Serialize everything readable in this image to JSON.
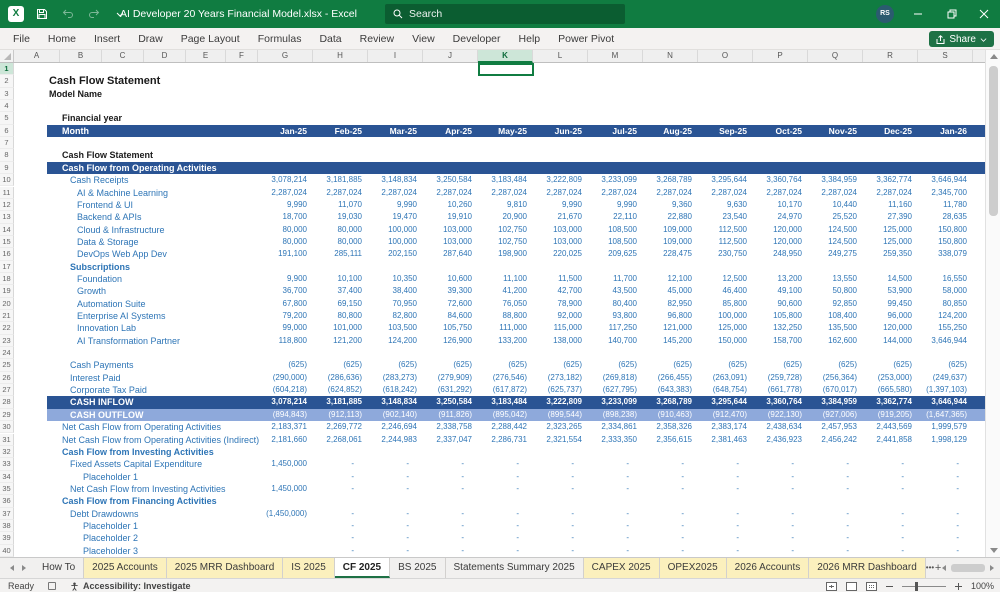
{
  "titlebar": {
    "title": "AI Developer 20 Years Financial Model.xlsx  -  Excel",
    "search_placeholder": "Search",
    "avatar_initials": "RS"
  },
  "menu": {
    "tabs": [
      "File",
      "Home",
      "Insert",
      "Draw",
      "Page Layout",
      "Formulas",
      "Data",
      "Review",
      "View",
      "Developer",
      "Help",
      "Power Pivot"
    ],
    "share_label": "Share"
  },
  "colors": {
    "titlebar_green": "#107C41",
    "banner_blue": "#2A5494",
    "outflow_blue": "#8EA9DB",
    "text_blue": "#2E75B6",
    "tab_yellow": "#FBF0BD",
    "accent_green": "#1E7145"
  },
  "sheet": {
    "columns": [
      "A",
      "B",
      "C",
      "D",
      "E",
      "F",
      "G",
      "H",
      "I",
      "J",
      "K",
      "L",
      "M",
      "N",
      "O",
      "P",
      "Q",
      "R",
      "S"
    ],
    "selected_column": "K",
    "selected_cell": "K1",
    "num_rows": 40,
    "rows": [
      {
        "n": 2,
        "label": "Cash Flow Statement",
        "style": "title",
        "indent": 1
      },
      {
        "n": 3,
        "label": "Model Name",
        "style": "bold",
        "indent": 1
      },
      {
        "n": 5,
        "label": "Financial year",
        "style": "bold",
        "indent": 2
      },
      {
        "n": 6,
        "label": "Month",
        "style": "month",
        "indent": 2,
        "values": [
          "Jan-25",
          "Feb-25",
          "Mar-25",
          "Apr-25",
          "May-25",
          "Jun-25",
          "Jul-25",
          "Aug-25",
          "Sep-25",
          "Oct-25",
          "Nov-25",
          "Dec-25",
          "Jan-26"
        ]
      },
      {
        "n": 8,
        "label": "Cash Flow Statement",
        "style": "bold",
        "indent": 2
      },
      {
        "n": 9,
        "label": "Cash Flow from Operating Activities",
        "style": "banner",
        "indent": 2
      },
      {
        "n": 10,
        "label": "Cash Receipts",
        "style": "blue",
        "indent": 3,
        "values": [
          "3,078,214",
          "3,181,885",
          "3,148,834",
          "3,250,584",
          "3,183,484",
          "3,222,809",
          "3,233,099",
          "3,268,789",
          "3,295,644",
          "3,360,764",
          "3,384,959",
          "3,362,774",
          "3,646,944"
        ]
      },
      {
        "n": 11,
        "label": "AI & Machine Learning",
        "style": "blue",
        "indent": 4,
        "values": [
          "2,287,024",
          "2,287,024",
          "2,287,024",
          "2,287,024",
          "2,287,024",
          "2,287,024",
          "2,287,024",
          "2,287,024",
          "2,287,024",
          "2,287,024",
          "2,287,024",
          "2,287,024",
          "2,345,700"
        ]
      },
      {
        "n": 12,
        "label": "Frontend & UI",
        "style": "blue",
        "indent": 4,
        "values": [
          "9,990",
          "11,070",
          "9,990",
          "10,260",
          "9,810",
          "9,990",
          "9,990",
          "9,360",
          "9,630",
          "10,170",
          "10,440",
          "11,160",
          "11,780"
        ]
      },
      {
        "n": 13,
        "label": "Backend & APIs",
        "style": "blue",
        "indent": 4,
        "values": [
          "18,700",
          "19,030",
          "19,470",
          "19,910",
          "20,900",
          "21,670",
          "22,110",
          "22,880",
          "23,540",
          "24,970",
          "25,520",
          "27,390",
          "28,635"
        ]
      },
      {
        "n": 14,
        "label": "Cloud & Infrastructure",
        "style": "blue",
        "indent": 4,
        "values": [
          "80,000",
          "80,000",
          "100,000",
          "103,000",
          "102,750",
          "103,000",
          "108,500",
          "109,000",
          "112,500",
          "120,000",
          "124,500",
          "125,000",
          "150,800"
        ]
      },
      {
        "n": 15,
        "label": "Data & Storage",
        "style": "blue",
        "indent": 4,
        "values": [
          "80,000",
          "80,000",
          "100,000",
          "103,000",
          "102,750",
          "103,000",
          "108,500",
          "109,000",
          "112,500",
          "120,000",
          "124,500",
          "125,000",
          "150,800"
        ]
      },
      {
        "n": 16,
        "label": "DevOps Web App Dev",
        "style": "blue",
        "indent": 4,
        "values": [
          "191,100",
          "285,111",
          "202,150",
          "287,640",
          "198,900",
          "220,025",
          "209,625",
          "228,475",
          "230,750",
          "248,950",
          "249,275",
          "259,350",
          "338,079"
        ]
      },
      {
        "n": 17,
        "label": "Subscriptions",
        "style": "blue-bold",
        "indent": 3
      },
      {
        "n": 18,
        "label": "Foundation",
        "style": "blue",
        "indent": 4,
        "values": [
          "9,900",
          "10,100",
          "10,350",
          "10,600",
          "11,100",
          "11,500",
          "11,700",
          "12,100",
          "12,500",
          "13,200",
          "13,550",
          "14,500",
          "16,550"
        ]
      },
      {
        "n": 19,
        "label": "Growth",
        "style": "blue",
        "indent": 4,
        "values": [
          "36,700",
          "37,400",
          "38,400",
          "39,300",
          "41,200",
          "42,700",
          "43,500",
          "45,000",
          "46,400",
          "49,100",
          "50,800",
          "53,900",
          "58,000"
        ]
      },
      {
        "n": 20,
        "label": "Automation Suite",
        "style": "blue",
        "indent": 4,
        "values": [
          "67,800",
          "69,150",
          "70,950",
          "72,600",
          "76,050",
          "78,900",
          "80,400",
          "82,950",
          "85,800",
          "90,600",
          "92,850",
          "99,450",
          "80,850"
        ]
      },
      {
        "n": 21,
        "label": "Enterprise AI Systems",
        "style": "blue",
        "indent": 4,
        "values": [
          "79,200",
          "80,800",
          "82,800",
          "84,600",
          "88,800",
          "92,000",
          "93,800",
          "96,800",
          "100,000",
          "105,800",
          "108,400",
          "96,000",
          "124,200"
        ]
      },
      {
        "n": 22,
        "label": "Innovation Lab",
        "style": "blue",
        "indent": 4,
        "values": [
          "99,000",
          "101,000",
          "103,500",
          "105,750",
          "111,000",
          "115,000",
          "117,250",
          "121,000",
          "125,000",
          "132,250",
          "135,500",
          "120,000",
          "155,250"
        ]
      },
      {
        "n": 23,
        "label": "AI Transformation Partner",
        "style": "blue",
        "indent": 4,
        "values": [
          "118,800",
          "121,200",
          "124,200",
          "126,900",
          "133,200",
          "138,000",
          "140,700",
          "145,200",
          "150,000",
          "158,700",
          "162,600",
          "144,000",
          "3,646,944"
        ]
      },
      {
        "n": 25,
        "label": "Cash Payments",
        "style": "blue",
        "indent": 3,
        "values": [
          "(625)",
          "(625)",
          "(625)",
          "(625)",
          "(625)",
          "(625)",
          "(625)",
          "(625)",
          "(625)",
          "(625)",
          "(625)",
          "(625)",
          "(625)"
        ]
      },
      {
        "n": 26,
        "label": "Interest Paid",
        "style": "blue",
        "indent": 3,
        "values": [
          "(290,000)",
          "(286,636)",
          "(283,273)",
          "(279,909)",
          "(276,546)",
          "(273,182)",
          "(269,818)",
          "(266,455)",
          "(263,091)",
          "(259,728)",
          "(256,364)",
          "(253,000)",
          "(249,637)"
        ]
      },
      {
        "n": 27,
        "label": "Corporate Tax Paid",
        "style": "blue",
        "indent": 3,
        "values": [
          "(604,218)",
          "(624,852)",
          "(618,242)",
          "(631,292)",
          "(617,872)",
          "(625,737)",
          "(627,795)",
          "(643,383)",
          "(648,754)",
          "(661,778)",
          "(670,017)",
          "(665,580)",
          "(1,397,103)"
        ]
      },
      {
        "n": 28,
        "label": "CASH INFLOW",
        "style": "banner-values",
        "indent": 3,
        "values": [
          "3,078,214",
          "3,181,885",
          "3,148,834",
          "3,250,584",
          "3,183,484",
          "3,222,809",
          "3,233,099",
          "3,268,789",
          "3,295,644",
          "3,360,764",
          "3,384,959",
          "3,362,774",
          "3,646,944"
        ]
      },
      {
        "n": 29,
        "label": "CASH OUTFLOW",
        "style": "outflow",
        "indent": 3,
        "values": [
          "(894,843)",
          "(912,113)",
          "(902,140)",
          "(911,826)",
          "(895,042)",
          "(899,544)",
          "(898,238)",
          "(910,463)",
          "(912,470)",
          "(922,130)",
          "(927,006)",
          "(919,205)",
          "(1,647,365)"
        ]
      },
      {
        "n": 30,
        "label": "Net Cash Flow from Operating Activities",
        "style": "blue",
        "indent": 2,
        "values": [
          "2,183,371",
          "2,269,772",
          "2,246,694",
          "2,338,758",
          "2,288,442",
          "2,323,265",
          "2,334,861",
          "2,358,326",
          "2,383,174",
          "2,438,634",
          "2,457,953",
          "2,443,569",
          "1,999,579"
        ]
      },
      {
        "n": 31,
        "label": "Net Cash Flow from Operating Activities (Indirect)",
        "style": "blue",
        "indent": 2,
        "values": [
          "2,181,660",
          "2,268,061",
          "2,244,983",
          "2,337,047",
          "2,286,731",
          "2,321,554",
          "2,333,350",
          "2,356,615",
          "2,381,463",
          "2,436,923",
          "2,456,242",
          "2,441,858",
          "1,998,129"
        ]
      },
      {
        "n": 32,
        "label": "Cash Flow from Investing Activities",
        "style": "blue-bold",
        "indent": 2
      },
      {
        "n": 33,
        "label": "Fixed Assets Capital Expenditure",
        "style": "blue",
        "indent": 3,
        "values": [
          "1,450,000",
          "-",
          "-",
          "-",
          "-",
          "-",
          "-",
          "-",
          "-",
          "-",
          "-",
          "-",
          "-"
        ]
      },
      {
        "n": 34,
        "label": "Placeholder 1",
        "style": "blue",
        "indent": 5,
        "values": [
          "",
          "-",
          "-",
          "-",
          "-",
          "-",
          "-",
          "-",
          "-",
          "-",
          "-",
          "-",
          "-"
        ]
      },
      {
        "n": 35,
        "label": "Net Cash Flow from Investing Activities",
        "style": "blue",
        "indent": 3,
        "values": [
          "1,450,000",
          "-",
          "-",
          "-",
          "-",
          "-",
          "-",
          "-",
          "-",
          "-",
          "-",
          "-",
          "-"
        ]
      },
      {
        "n": 36,
        "label": "Cash Flow from Financing Activities",
        "style": "blue-bold",
        "indent": 2
      },
      {
        "n": 37,
        "label": "Debt Drawdowns",
        "style": "blue",
        "indent": 3,
        "values": [
          "(1,450,000)",
          "-",
          "-",
          "-",
          "-",
          "-",
          "-",
          "-",
          "-",
          "-",
          "-",
          "-",
          "-"
        ]
      },
      {
        "n": 38,
        "label": "Placeholder 1",
        "style": "blue",
        "indent": 5,
        "values": [
          "",
          "-",
          "-",
          "-",
          "-",
          "-",
          "-",
          "-",
          "-",
          "-",
          "-",
          "-",
          "-"
        ]
      },
      {
        "n": 39,
        "label": "Placeholder 2",
        "style": "blue",
        "indent": 5,
        "values": [
          "",
          "-",
          "-",
          "-",
          "-",
          "-",
          "-",
          "-",
          "-",
          "-",
          "-",
          "-",
          "-"
        ]
      },
      {
        "n": 40,
        "label": "Placeholder 3",
        "style": "blue",
        "indent": 5,
        "values": [
          "",
          "-",
          "-",
          "-",
          "-",
          "-",
          "-",
          "-",
          "-",
          "-",
          "-",
          "-",
          "-"
        ]
      }
    ]
  },
  "sheet_tabs": {
    "tabs": [
      {
        "label": "How To",
        "style": "plain"
      },
      {
        "label": "2025 Accounts",
        "style": "yellow"
      },
      {
        "label": "2025 MRR Dashboard",
        "style": "yellow"
      },
      {
        "label": "IS 2025",
        "style": "yellow"
      },
      {
        "label": "CF 2025",
        "style": "active"
      },
      {
        "label": "BS 2025",
        "style": "plain"
      },
      {
        "label": "Statements Summary 2025",
        "style": "plain"
      },
      {
        "label": "CAPEX 2025",
        "style": "yellow"
      },
      {
        "label": "OPEX2025",
        "style": "yellow"
      },
      {
        "label": "2026 Accounts",
        "style": "yellow"
      },
      {
        "label": "2026 MRR Dashboard",
        "style": "yellow"
      }
    ],
    "more_label": "•••",
    "add_label": "+"
  },
  "status_bar": {
    "ready": "Ready",
    "accessibility": "Accessibility: Investigate",
    "zoom_level": "100%"
  }
}
